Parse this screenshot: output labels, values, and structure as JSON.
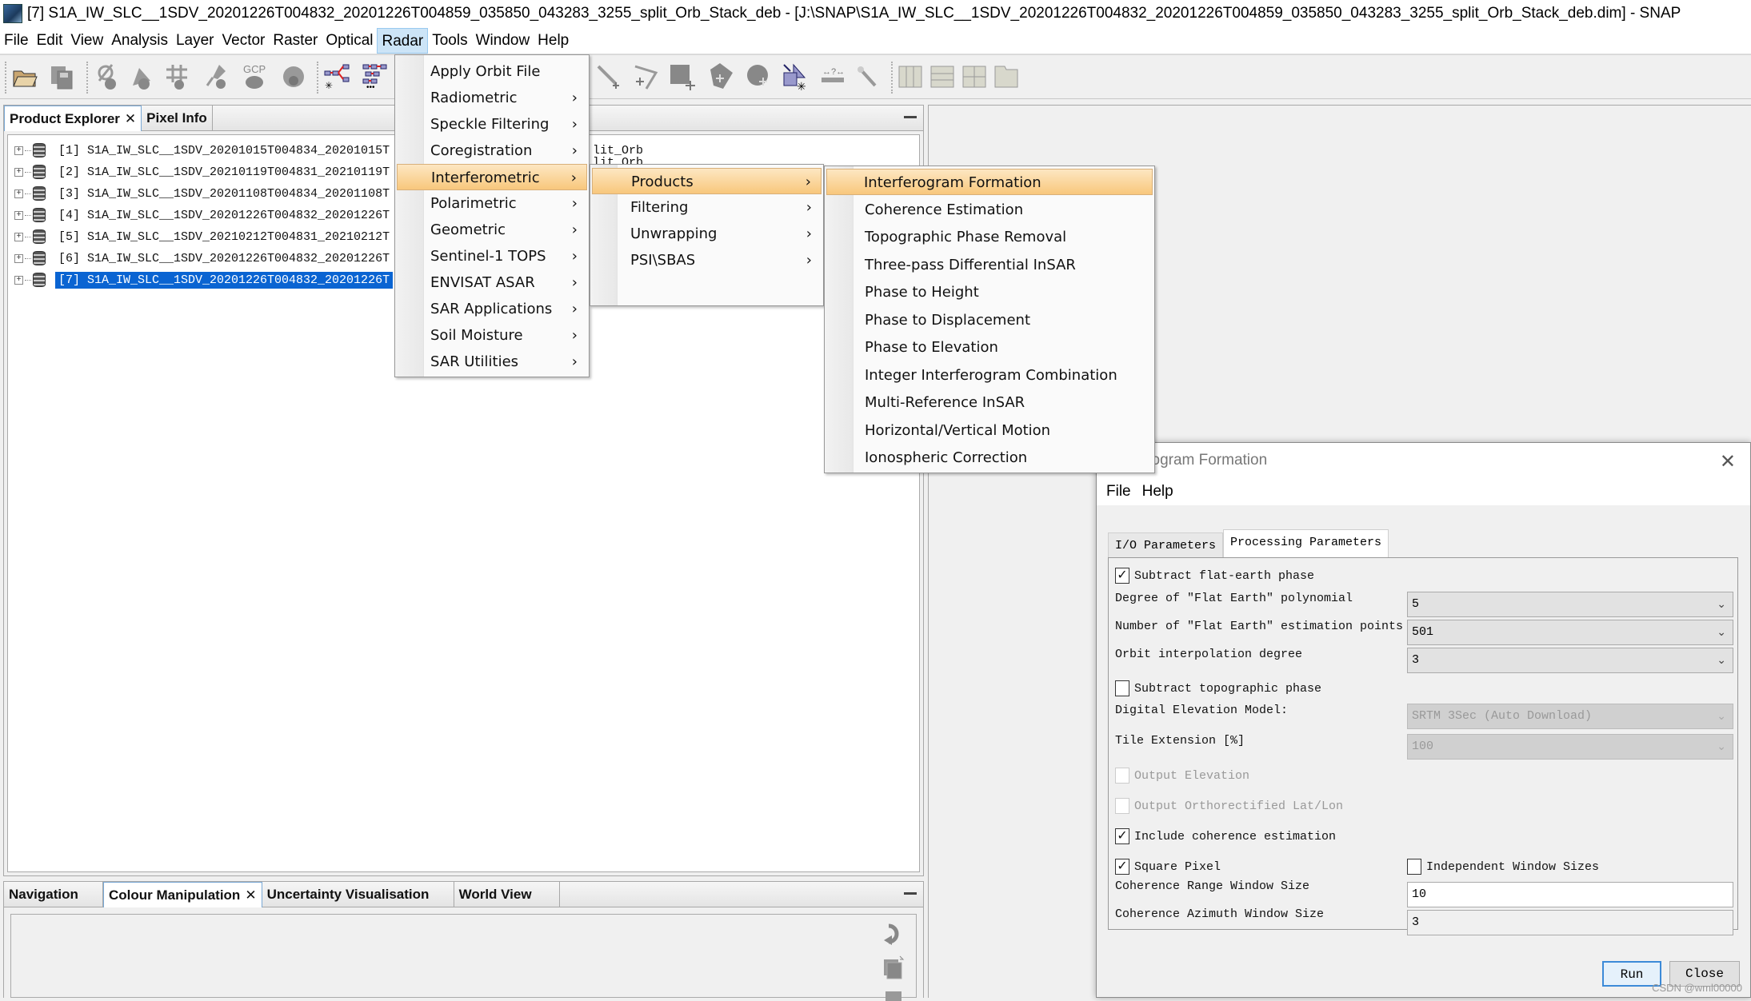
{
  "window": {
    "title": "[7] S1A_IW_SLC__1SDV_20201226T004832_20201226T004859_035850_043283_3255_split_Orb_Stack_deb - [J:\\SNAP\\S1A_IW_SLC__1SDV_20201226T004832_20201226T004859_035850_043283_3255_split_Orb_Stack_deb.dim] - SNAP"
  },
  "menubar": [
    "File",
    "Edit",
    "View",
    "Analysis",
    "Layer",
    "Vector",
    "Raster",
    "Optical",
    "Radar",
    "Tools",
    "Window",
    "Help"
  ],
  "menubar_active": "Radar",
  "toolbar": {
    "icons": [
      "open-product-icon",
      "save-product-icon",
      "no-data-overlay-icon",
      "mask-overlay-icon",
      "graticule-overlay-icon",
      "pin-overlay-icon",
      "gcp-overlay-icon",
      "shape-overlay-icon",
      "graph-builder-icon",
      "batch-processing-icon",
      "line-draw-icon",
      "polyline-draw-icon",
      "rectangle-draw-icon",
      "polygon-draw-icon",
      "ellipse-draw-icon",
      "new-vector-container-icon",
      "range-finder-icon",
      "magic-wand-icon",
      "tile-horizontal-icon",
      "tile-vertical-icon",
      "tile-grid-icon",
      "tile-evenly-icon"
    ],
    "gcp_label": "GCP"
  },
  "product_explorer": {
    "tabs": [
      {
        "label": "Product Explorer",
        "closable": true,
        "selected": true
      },
      {
        "label": "Pixel Info",
        "closable": false,
        "selected": false
      }
    ],
    "products": [
      {
        "label": "[1] S1A_IW_SLC__1SDV_20201015T004834_20201015T",
        "suffix": "lit_Orb",
        "selected": false
      },
      {
        "label": "[2] S1A_IW_SLC__1SDV_20210119T004831_20210119T",
        "suffix": "lit_Orb",
        "selected": false
      },
      {
        "label": "[3] S1A_IW_SLC__1SDV_20201108T004834_20201108T",
        "suffix": "",
        "selected": false
      },
      {
        "label": "[4] S1A_IW_SLC__1SDV_20201226T004832_20201226T",
        "suffix": "",
        "selected": false
      },
      {
        "label": "[5] S1A_IW_SLC__1SDV_20210212T004831_20210212T",
        "suffix": "",
        "selected": false
      },
      {
        "label": "[6] S1A_IW_SLC__1SDV_20201226T004832_20201226T",
        "suffix": "",
        "selected": false
      },
      {
        "label": "[7] S1A_IW_SLC__1SDV_20201226T004832_20201226T",
        "suffix": "",
        "selected": true
      }
    ]
  },
  "bottom_panel": {
    "tabs": [
      {
        "label": "Navigation",
        "closable": false,
        "selected": false
      },
      {
        "label": "Colour Manipulation",
        "closable": true,
        "selected": true
      },
      {
        "label": "Uncertainty Visualisation",
        "closable": false,
        "selected": false
      },
      {
        "label": "World View",
        "closable": false,
        "selected": false
      }
    ],
    "side_icons": [
      "reset-icon",
      "import-palette-icon",
      "export-palette-icon"
    ]
  },
  "radar_menu": {
    "items": [
      {
        "label": "Apply Orbit File",
        "submenu": false
      },
      {
        "label": "Radiometric",
        "submenu": true
      },
      {
        "label": "Speckle Filtering",
        "submenu": true
      },
      {
        "label": "Coregistration",
        "submenu": true
      },
      {
        "label": "Interferometric",
        "submenu": true,
        "highlighted": true
      },
      {
        "label": "Polarimetric",
        "submenu": true
      },
      {
        "label": "Geometric",
        "submenu": true
      },
      {
        "label": "Sentinel-1 TOPS",
        "submenu": true
      },
      {
        "label": "ENVISAT ASAR",
        "submenu": true
      },
      {
        "label": "SAR Applications",
        "submenu": true
      },
      {
        "label": "Soil Moisture",
        "submenu": true
      },
      {
        "label": "SAR Utilities",
        "submenu": true
      }
    ]
  },
  "interferometric_menu": {
    "items": [
      {
        "label": "Products",
        "submenu": true,
        "highlighted": true
      },
      {
        "label": "Filtering",
        "submenu": true
      },
      {
        "label": "Unwrapping",
        "submenu": true
      },
      {
        "label": "PSI\\SBAS",
        "submenu": true
      }
    ]
  },
  "products_menu": {
    "items": [
      {
        "label": "Interferogram Formation",
        "highlighted": true
      },
      {
        "label": "Coherence Estimation"
      },
      {
        "label": "Topographic Phase Removal"
      },
      {
        "label": "Three-pass Differential InSAR"
      },
      {
        "label": "Phase to Height"
      },
      {
        "label": "Phase to Displacement"
      },
      {
        "label": "Phase to Elevation"
      },
      {
        "label": "Integer Interferogram Combination"
      },
      {
        "label": "Multi-Reference InSAR"
      },
      {
        "label": "Horizontal/Vertical Motion"
      },
      {
        "label": "Ionospheric Correction"
      }
    ]
  },
  "dialog": {
    "title": "Interferogram Formation",
    "title_visible": "rferogram Formation",
    "close_glyph": "✕",
    "menu": [
      "File",
      "Help"
    ],
    "tabs": [
      {
        "label": "I/O Parameters",
        "selected": false
      },
      {
        "label": "Processing Parameters",
        "selected": true
      }
    ],
    "params": {
      "subtract_flat_earth": {
        "label": "Subtract flat-earth phase",
        "checked": true,
        "enabled": true
      },
      "flat_earth_degree": {
        "label": "Degree of \"Flat Earth\" polynomial",
        "value": "5",
        "enabled": true
      },
      "flat_earth_points": {
        "label": "Number of \"Flat Earth\" estimation points",
        "value": "501",
        "enabled": true
      },
      "orbit_degree": {
        "label": "Orbit interpolation degree",
        "value": "3",
        "enabled": true
      },
      "subtract_topo": {
        "label": "Subtract topographic phase",
        "checked": false,
        "enabled": true
      },
      "dem": {
        "label": "Digital Elevation Model:",
        "value": "SRTM 3Sec (Auto Download)",
        "enabled": false
      },
      "tile_extension": {
        "label": "Tile Extension [%]",
        "value": "100",
        "enabled": false
      },
      "output_elevation": {
        "label": "Output Elevation",
        "checked": false,
        "enabled": false
      },
      "output_latlon": {
        "label": "Output Orthorectified Lat/Lon",
        "checked": false,
        "enabled": false
      },
      "include_coherence": {
        "label": "Include coherence estimation",
        "checked": true,
        "enabled": true
      },
      "square_pixel": {
        "label": "Square Pixel",
        "checked": true,
        "enabled": true
      },
      "independent_window": {
        "label": "Independent Window Sizes",
        "checked": false,
        "enabled": true
      },
      "coh_range_window": {
        "label": "Coherence Range Window Size",
        "value": "10",
        "enabled": true
      },
      "coh_azimuth_window": {
        "label": "Coherence Azimuth Window Size",
        "value": "3",
        "enabled": false
      }
    },
    "buttons": {
      "run": "Run",
      "close": "Close"
    }
  },
  "watermark": "CSDN @wml00000",
  "glyphs": {
    "check": "✓",
    "chevron_right": "›",
    "chevron_down": "⌄",
    "tab_close": "✕",
    "tree_plus": "+"
  }
}
